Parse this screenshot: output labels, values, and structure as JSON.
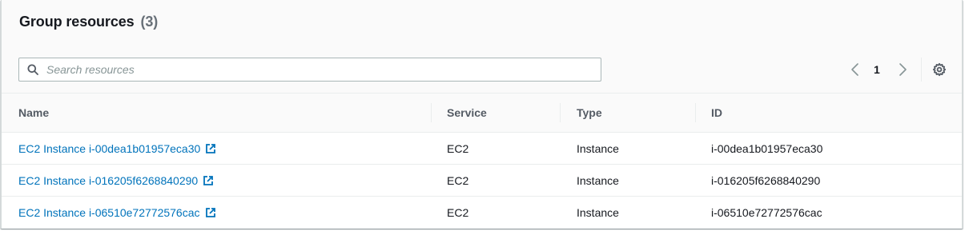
{
  "header": {
    "title": "Group resources",
    "count": "(3)"
  },
  "search": {
    "placeholder": "Search resources",
    "value": ""
  },
  "pagination": {
    "current_page": "1"
  },
  "table": {
    "columns": [
      "Name",
      "Service",
      "Type",
      "ID"
    ],
    "rows": [
      {
        "name": "EC2 Instance i-00dea1b01957eca30",
        "service": "EC2",
        "type": "Instance",
        "id": "i-00dea1b01957eca30"
      },
      {
        "name": "EC2 Instance i-016205f6268840290",
        "service": "EC2",
        "type": "Instance",
        "id": "i-016205f6268840290"
      },
      {
        "name": "EC2 Instance i-06510e72772576cac",
        "service": "EC2",
        "type": "Instance",
        "id": "i-06510e72772576cac"
      }
    ]
  },
  "icons": {
    "search": "search-icon",
    "prev": "chevron-left-icon",
    "next": "chevron-right-icon",
    "settings": "gear-icon",
    "external": "external-link-icon"
  },
  "colors": {
    "link": "#0073bb",
    "text": "#16191f",
    "muted": "#687078",
    "header_bg": "#fafafa",
    "border": "#eaeded"
  }
}
